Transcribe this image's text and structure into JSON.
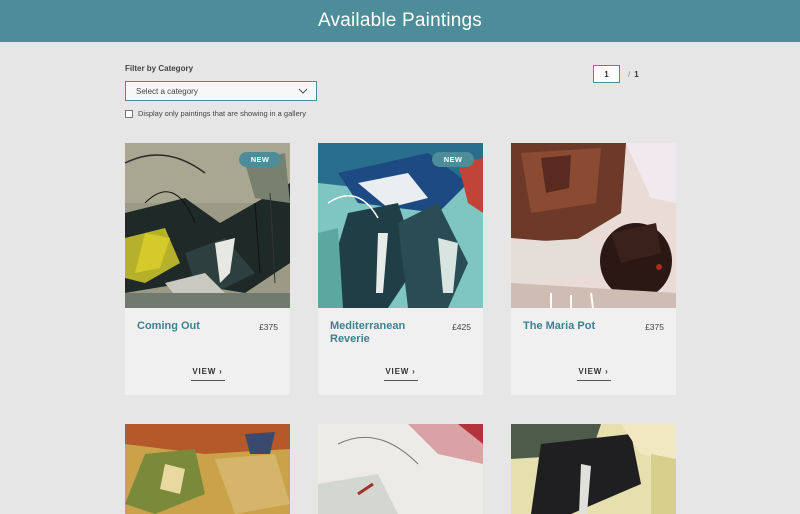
{
  "header": {
    "title": "Available Paintings"
  },
  "filter": {
    "label": "Filter by Category",
    "select_placeholder": "Select a category",
    "gallery_checkbox_label": "Display only paintings that are showing in a gallery"
  },
  "pagination": {
    "current": "1",
    "separator": "/",
    "total": "1"
  },
  "cards": [
    {
      "title": "Coming Out",
      "price": "£375",
      "badge": "NEW",
      "view": "VIEW ›"
    },
    {
      "title": "Mediterranean Reverie",
      "price": "£425",
      "badge": "NEW",
      "view": "VIEW ›"
    },
    {
      "title": "The Maria Pot",
      "price": "£375",
      "badge": "",
      "view": "VIEW ›"
    }
  ],
  "colors": {
    "accent": "#4c8d99",
    "background": "#e6e6e6",
    "card": "#f0f0f0"
  }
}
